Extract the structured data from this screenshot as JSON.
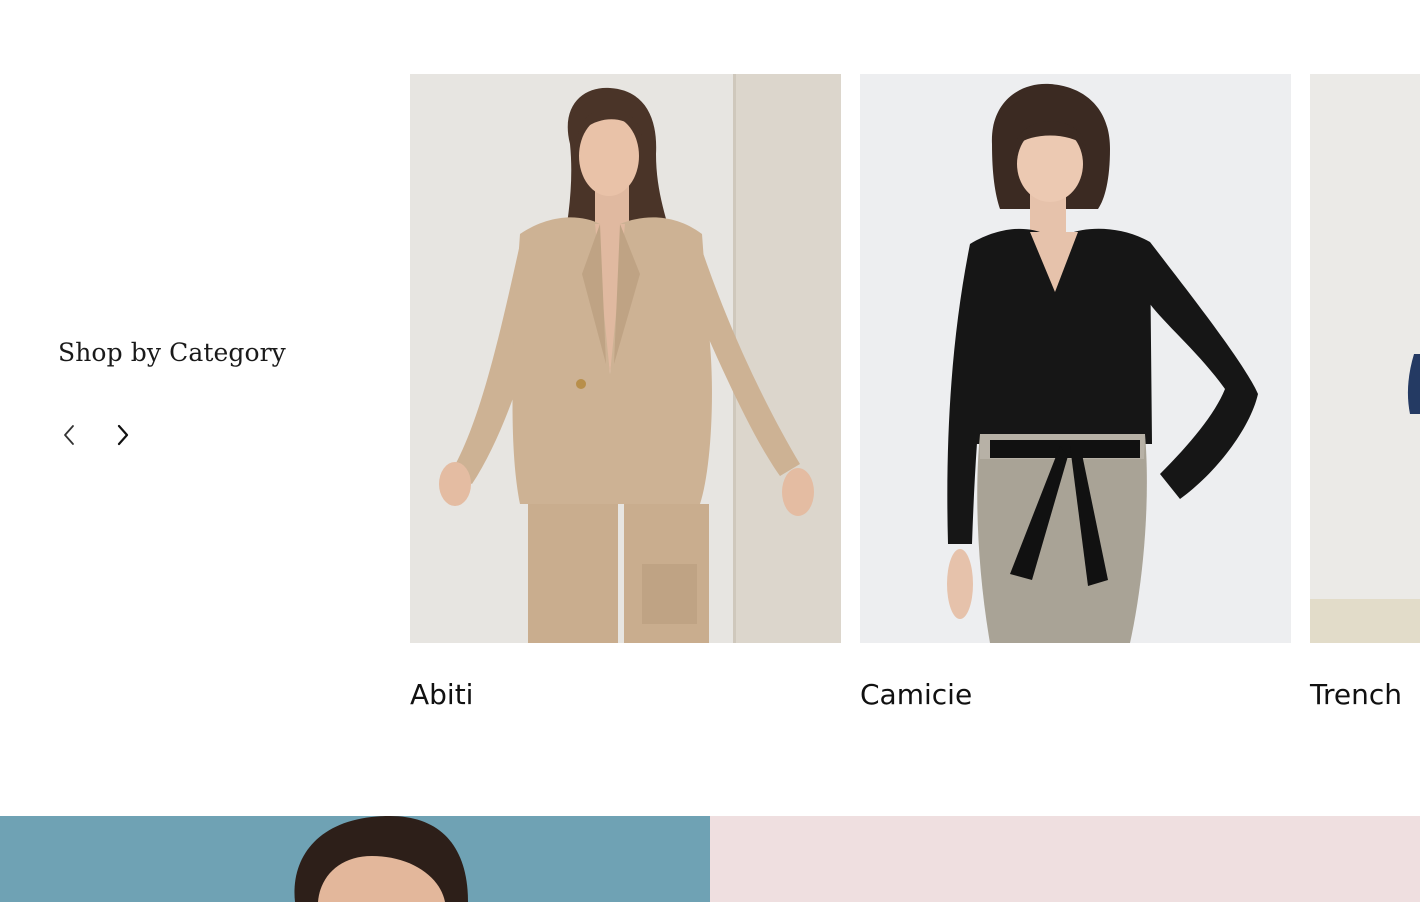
{
  "section": {
    "title": "Shop by Category"
  },
  "carousel": {
    "prev_icon": "chevron-left-icon",
    "next_icon": "chevron-right-icon",
    "categories": [
      {
        "label": "Abiti"
      },
      {
        "label": "Camicie"
      },
      {
        "label": "Trench"
      }
    ]
  },
  "colors": {
    "text": "#111111",
    "banner_blue": "#6fa2b4",
    "banner_pink": "#efdfe0",
    "abiti_bg": "#e6e4df",
    "abiti_outfit": "#cdb294",
    "camicie_bg": "#eceef0",
    "camicie_top": "#161616",
    "camicie_trousers": "#a9a396"
  }
}
